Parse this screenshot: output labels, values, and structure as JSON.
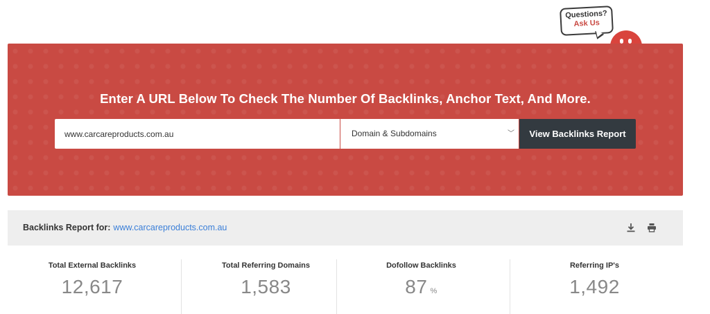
{
  "mascot": {
    "line1": "Questions?",
    "line2": "Ask Us"
  },
  "hero": {
    "title": "Enter A URL Below To Check The Number Of Backlinks, Anchor Text, And More.",
    "url_value": "www.carcareproducts.com.au",
    "scope_selected": "Domain & Subdomains",
    "submit_label": "View Backlinks Report"
  },
  "report": {
    "label": "Backlinks Report for:",
    "domain": "www.carcareproducts.com.au",
    "icons": [
      "download-icon",
      "print-icon"
    ]
  },
  "stats": [
    {
      "label": "Total External Backlinks",
      "value": "12,617",
      "unit": ""
    },
    {
      "label": "Total Referring Domains",
      "value": "1,583",
      "unit": ""
    },
    {
      "label": "Dofollow Backlinks",
      "value": "87",
      "unit": "%"
    },
    {
      "label": "Referring IP's",
      "value": "1,492",
      "unit": ""
    }
  ],
  "colors": {
    "hero_bg": "#c94a43",
    "button_bg": "#333a40",
    "link": "#3b7fd8",
    "report_bar_bg": "#eeeeee"
  }
}
